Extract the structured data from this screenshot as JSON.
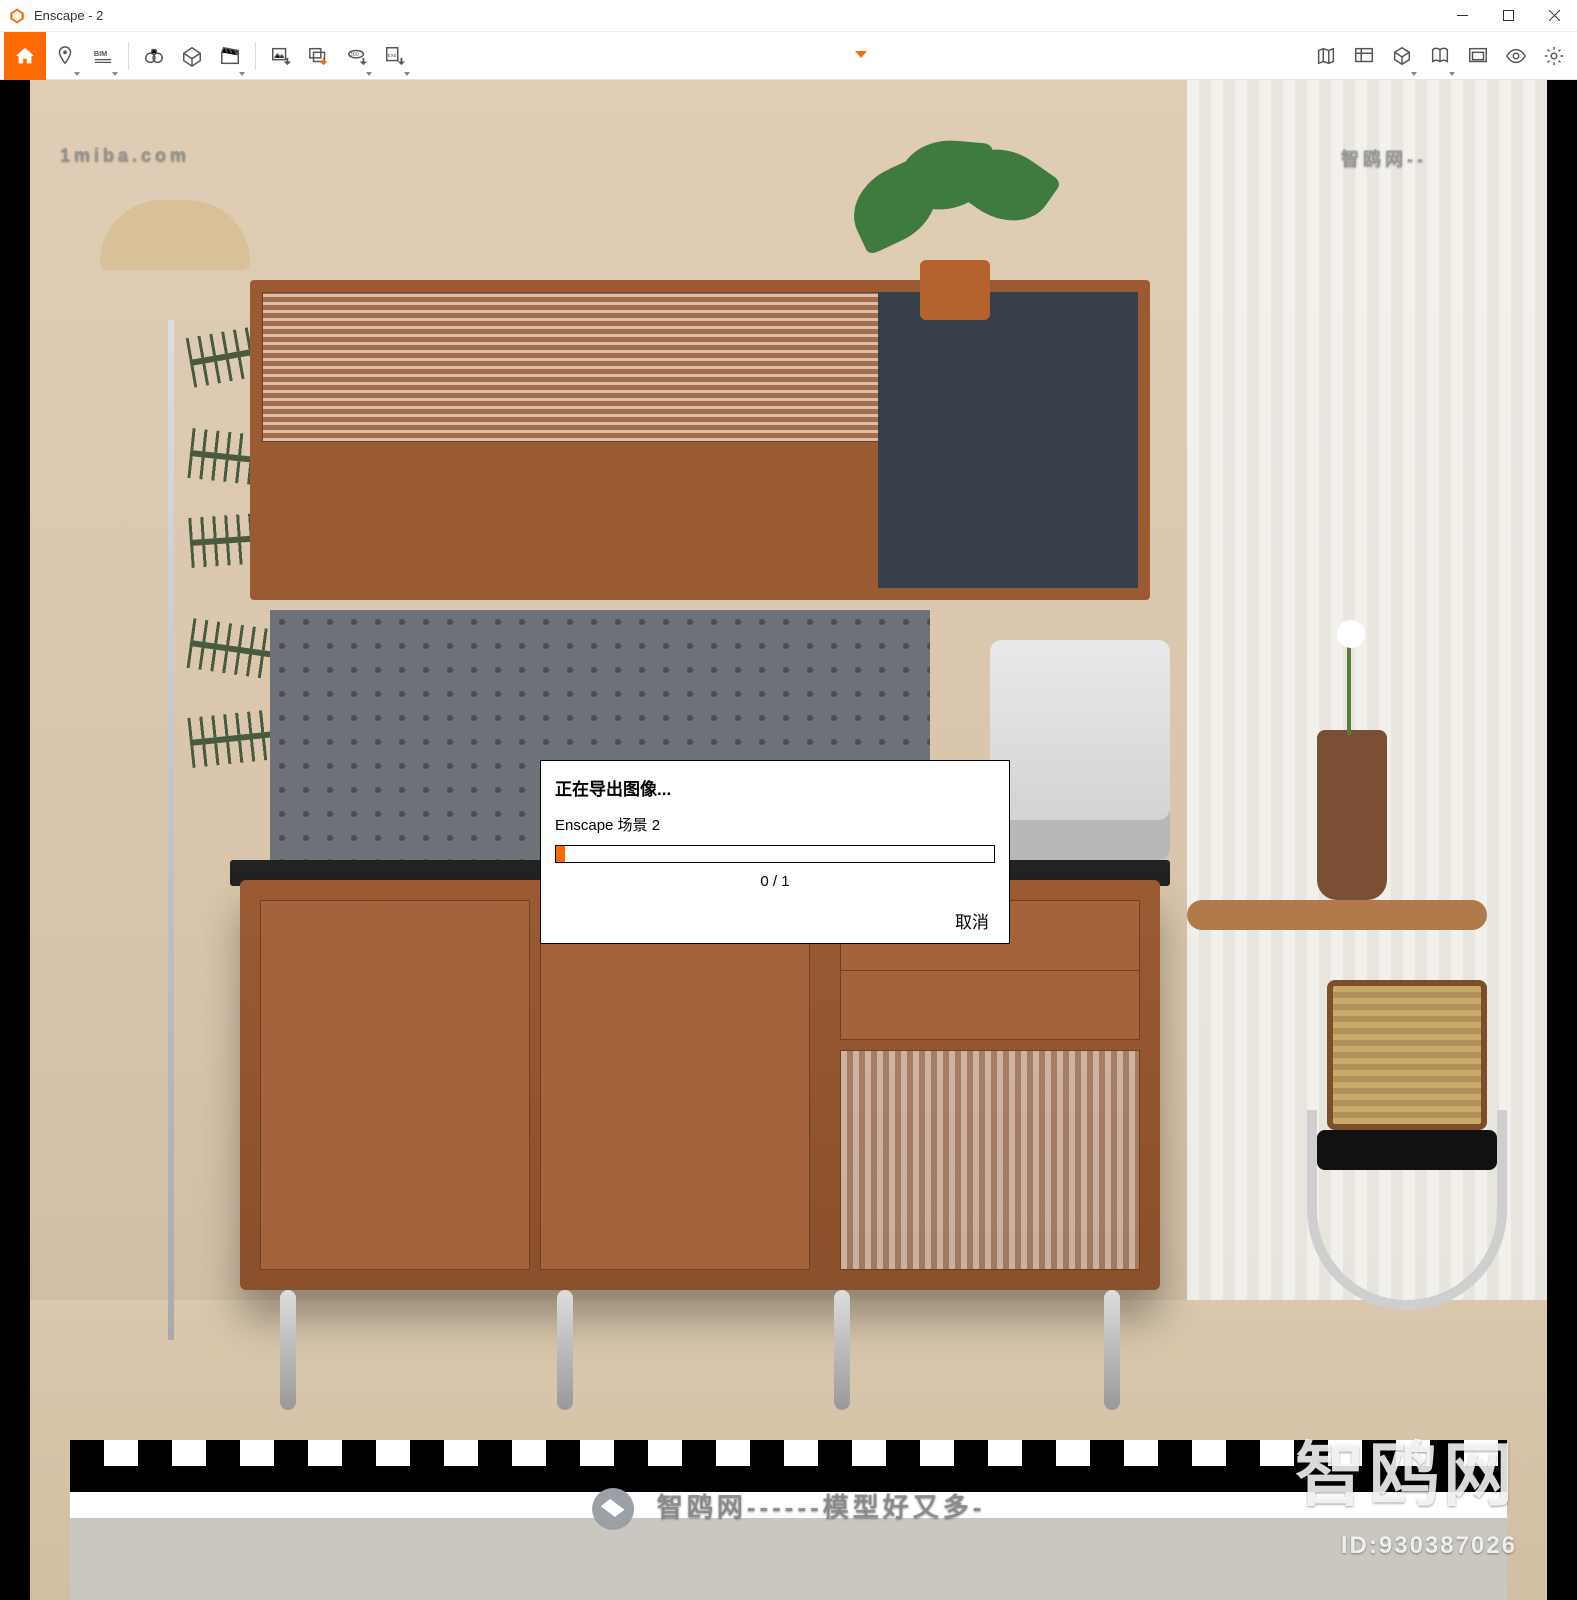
{
  "window": {
    "title": "Enscape - 2"
  },
  "toolbar": {
    "home": "home",
    "items_left": [
      "pin",
      "bim",
      "binoculars",
      "camera-frame",
      "clapper",
      "export-image",
      "export-swap",
      "export-360",
      "export-exe"
    ],
    "items_right": [
      "map",
      "gallery",
      "cube",
      "book",
      "window-frame",
      "eye",
      "gear"
    ]
  },
  "dialog": {
    "title": "正在导出图像...",
    "subtitle": "Enscape 场景 2",
    "progress_text": "0 / 1",
    "cancel": "取消",
    "progress_value": 0,
    "progress_max": 1
  },
  "watermarks": {
    "brand_big": "智鸥网",
    "id_label": "ID:930387026",
    "mid_text": "智鸥网------模型好又多-",
    "top_left": "1miba.com",
    "top_right": "智鸥网--"
  }
}
